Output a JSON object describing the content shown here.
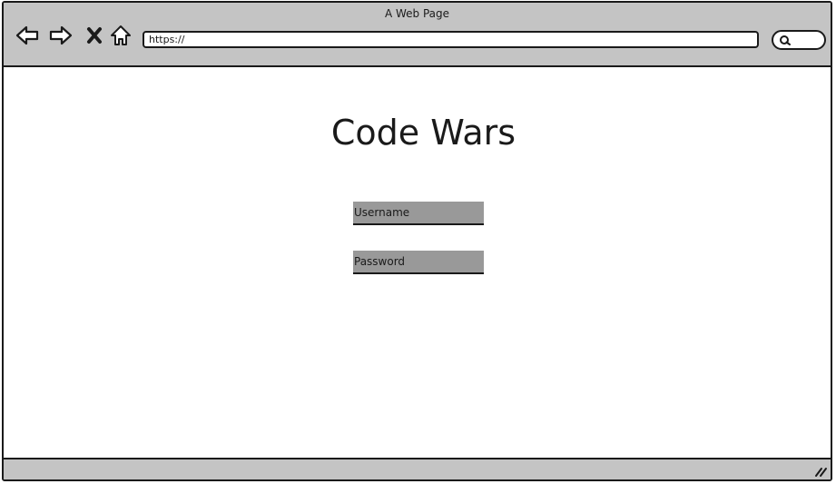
{
  "window": {
    "title": "A Web Page"
  },
  "toolbar": {
    "back_icon": "back-arrow-icon",
    "forward_icon": "forward-arrow-icon",
    "stop_icon": "close-icon",
    "home_icon": "home-icon",
    "address": "https://",
    "search_icon": "search-icon"
  },
  "page": {
    "heading": "Code Wars",
    "username_placeholder": "Username",
    "password_placeholder": "Password"
  },
  "statusbar": {
    "resize_icon": "resize-grip-icon"
  },
  "colors": {
    "chrome": "#c4c4c4",
    "field_background": "#999999",
    "outline": "#1a1a1a",
    "page_background": "#ffffff"
  }
}
